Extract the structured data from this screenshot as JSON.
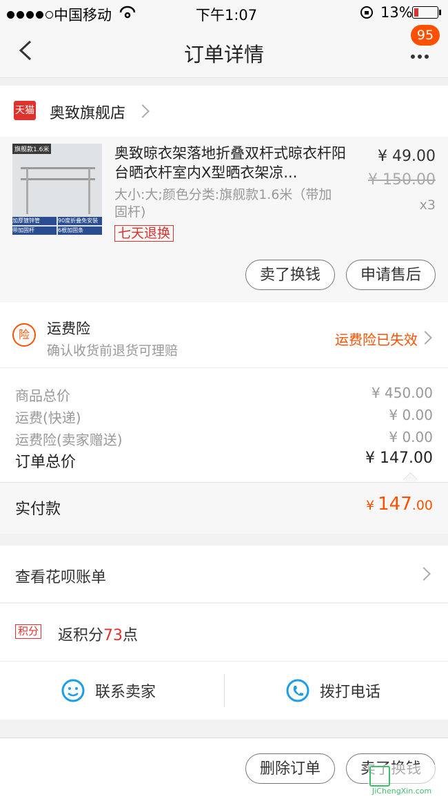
{
  "status_bar": {
    "carrier": "中国移动",
    "time": "下午1:07",
    "battery": "13%"
  },
  "nav": {
    "title": "订单详情",
    "badge": "95"
  },
  "shop": {
    "tag": "天猫",
    "name": "奥致旗舰店"
  },
  "product": {
    "title": "奥致晾衣架落地折叠双杆式晾衣杆阳台晒衣杆室内X型晒衣架凉...",
    "sku": "大小:大;颜色分类:旗舰款1.6米（带加固杆)",
    "price": "¥ 49.00",
    "original_price": "¥ 150.00",
    "quantity": "x3",
    "return_tag": "七天退换",
    "image_labels": {
      "model": "旗舰款1.6米",
      "a": "加厚镀锌管",
      "b": "90度折叠免安装",
      "c": "带加固杆",
      "d": "6根加固条"
    }
  },
  "actions": {
    "sell": "卖了换钱",
    "after_sale": "申请售后"
  },
  "insurance": {
    "icon_char": "险",
    "title": "运费险",
    "desc": "确认收货前退货可理赔",
    "status": "运费险已失效"
  },
  "payment": {
    "rows": [
      {
        "label": "商品总价",
        "value": "¥ 450.00"
      },
      {
        "label": "运费(快递)",
        "value": "¥ 0.00"
      },
      {
        "label": "运费险(卖家赠送)",
        "value": "¥ 0.00"
      }
    ],
    "total_label": "订单总价",
    "total_value": "¥ 147.00",
    "paid_label": "实付款",
    "paid_symbol": "¥",
    "paid_int": "147",
    "paid_dec": ".00"
  },
  "huabei": {
    "label": "查看花呗账单"
  },
  "points": {
    "tag": "积分",
    "prefix": "返积分",
    "value": "73",
    "suffix": "点"
  },
  "contact": {
    "seller": "联系卖家",
    "phone": "拨打电话"
  },
  "footer": {
    "delete": "删除订单",
    "sell": "卖了换钱"
  },
  "watermark": {
    "brand": "JiChengXin.com"
  },
  "colors": {
    "accent": "#ff5000",
    "tmall_red": "#e0322d",
    "price_orange": "#ff5000",
    "phone_blue": "#1a9ee8"
  }
}
